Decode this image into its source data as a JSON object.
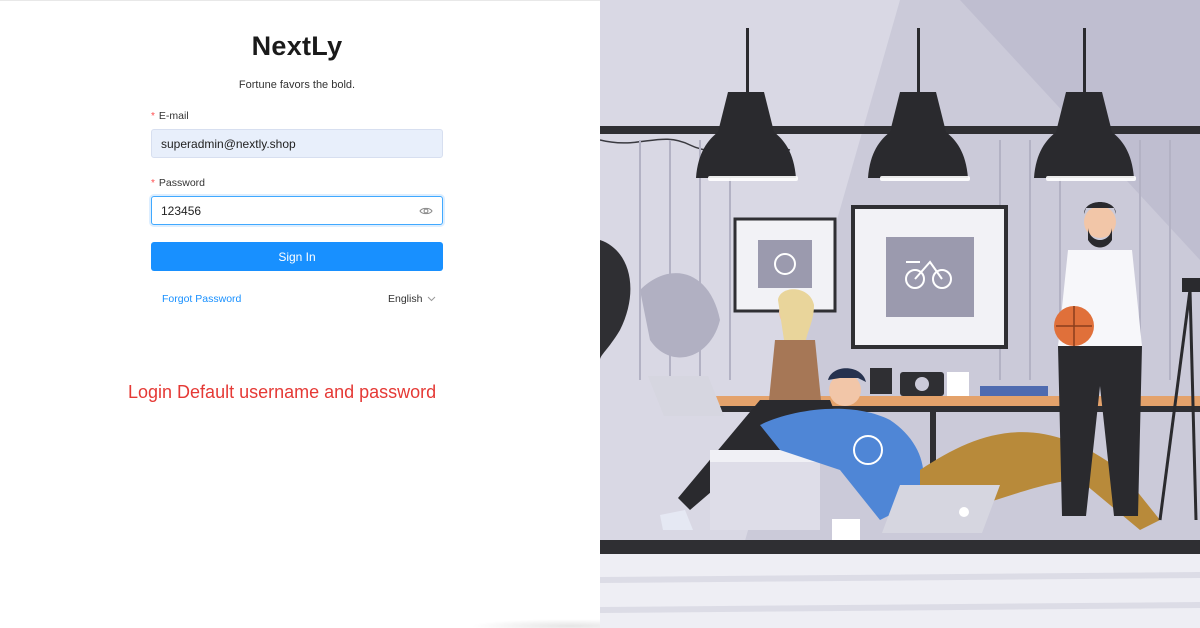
{
  "app": {
    "brand": "NextLy",
    "tagline": "Fortune favors the bold."
  },
  "form": {
    "email": {
      "label": "E-mail",
      "required_mark": "*",
      "value": "superadmin@nextly.shop"
    },
    "password": {
      "label": "Password",
      "required_mark": "*",
      "value": "123456"
    },
    "signin_label": "Sign In",
    "forgot_label": "Forgot Password",
    "language": "English"
  },
  "annotation": {
    "text": "Login Default username and password"
  },
  "icons": {
    "password_toggle": "eye-icon",
    "language_dropdown": "chevron-down-icon"
  },
  "colors": {
    "primary": "#1890ff",
    "annotation": "#e53935",
    "required": "#ff4d4f",
    "illustration_bg": "#c9c8d8",
    "illustration_dark": "#2a2a2e"
  }
}
